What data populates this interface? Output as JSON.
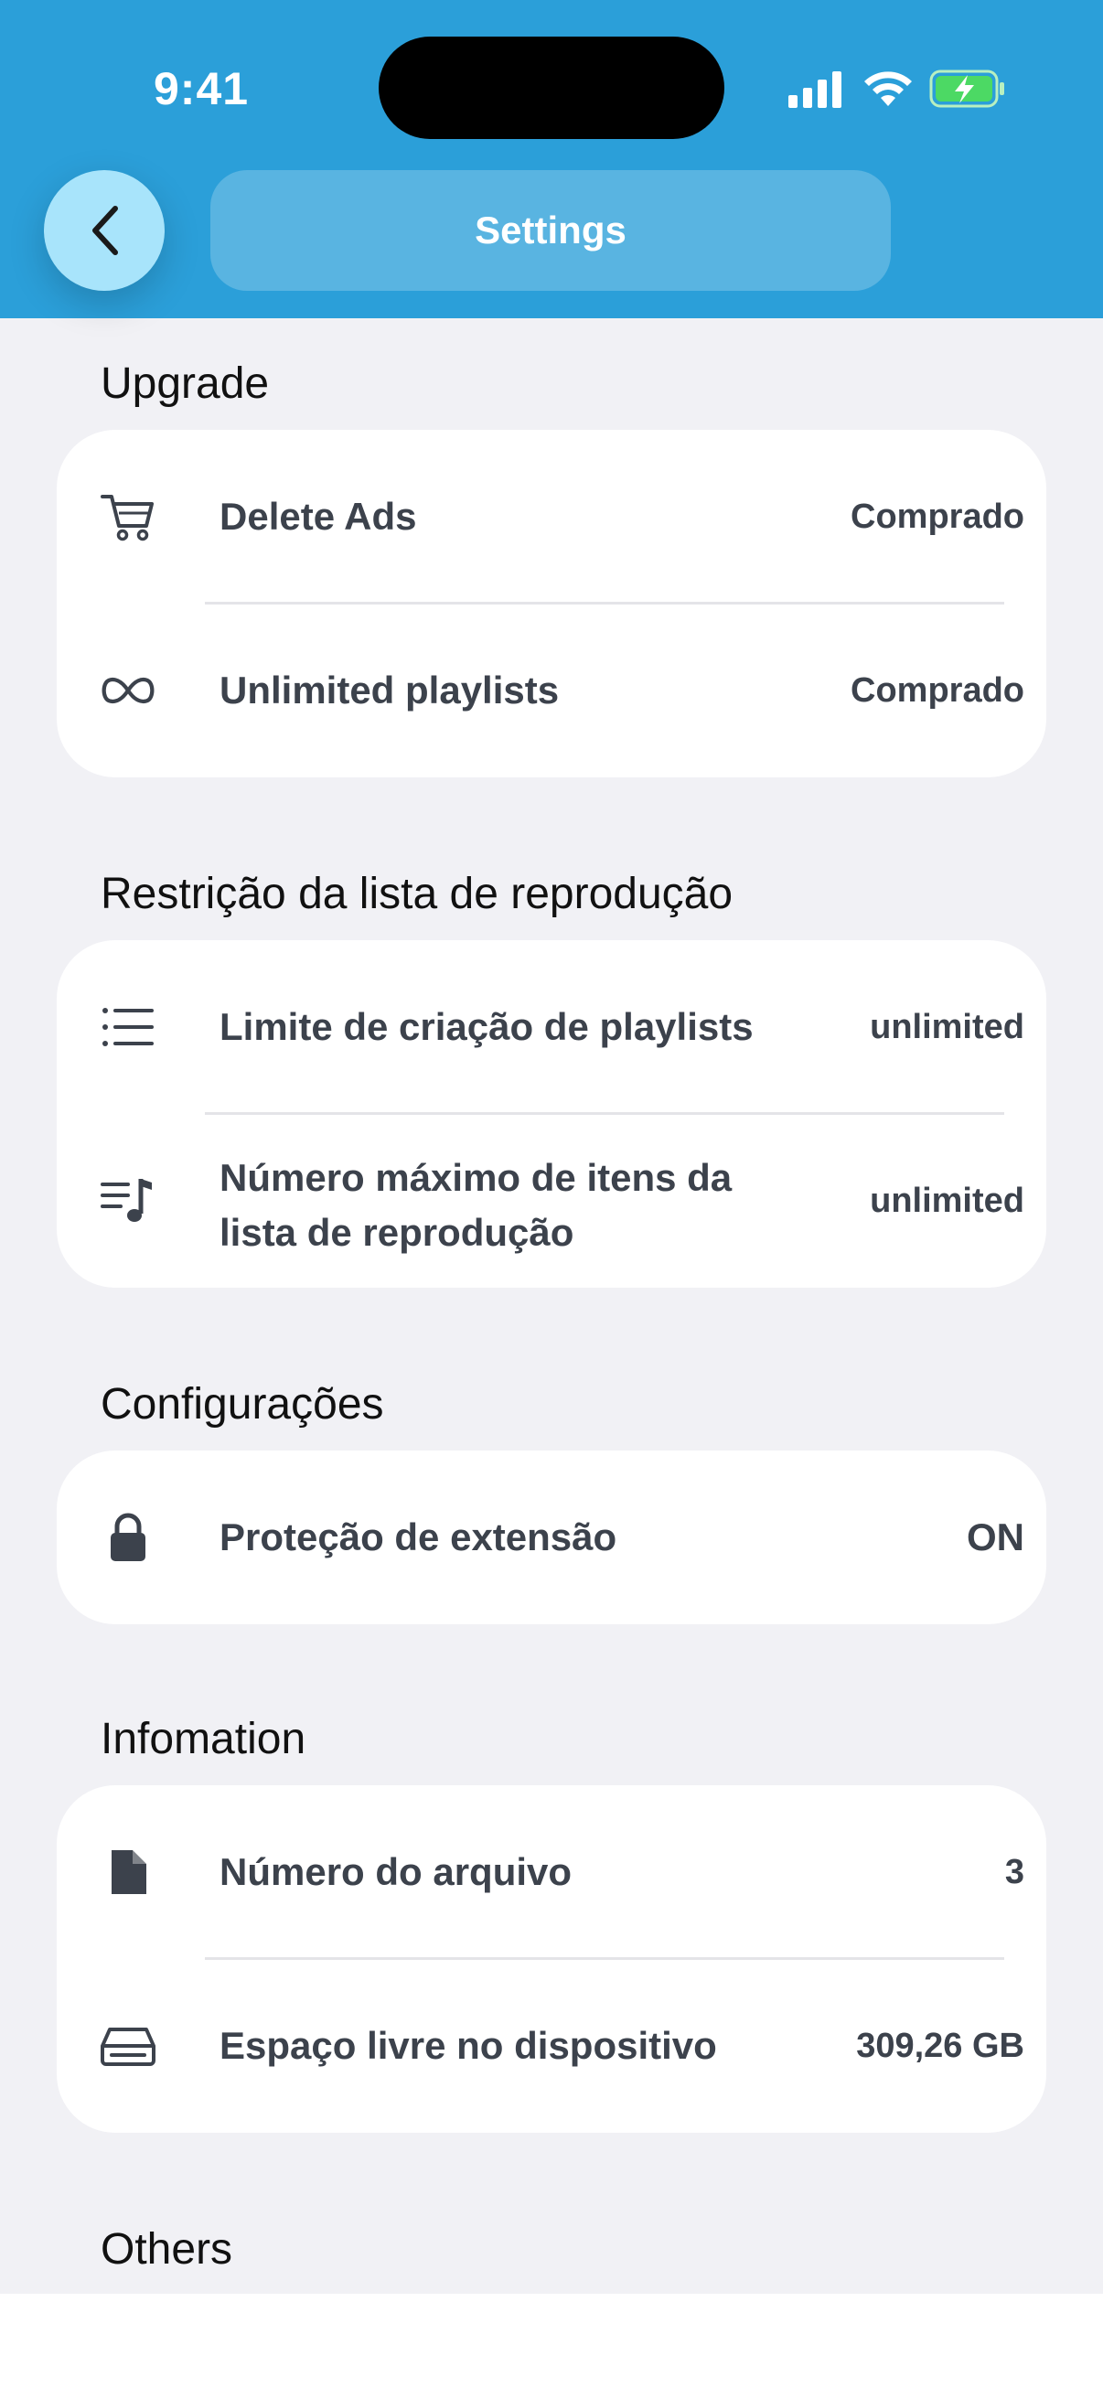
{
  "status_bar": {
    "time": "9:41"
  },
  "header": {
    "title": "Settings"
  },
  "sections": {
    "upgrade": {
      "title": "Upgrade",
      "rows": [
        {
          "label": "Delete Ads",
          "value": "Comprado",
          "icon": "cart-icon"
        },
        {
          "label": "Unlimited playlists",
          "value": "Comprado",
          "icon": "infinity-icon"
        }
      ]
    },
    "restriction": {
      "title": "Restrição da lista de reprodução",
      "rows": [
        {
          "label": "Limite de criação de playlists",
          "value": "unlimited",
          "icon": "list-icon"
        },
        {
          "label_line1": "Número máximo de itens da",
          "label_line2": "lista de reprodução",
          "value": "unlimited",
          "icon": "music-list-icon"
        }
      ]
    },
    "config": {
      "title": "Configurações",
      "rows": [
        {
          "label": "Proteção de extensão",
          "value": "ON",
          "icon": "lock-icon"
        }
      ]
    },
    "info": {
      "title": "Infomation",
      "rows": [
        {
          "label": "Número do arquivo",
          "value": "3",
          "icon": "file-icon"
        },
        {
          "label": "Espaço livre no dispositivo",
          "value": "309,26 GB",
          "icon": "storage-icon"
        }
      ]
    },
    "others": {
      "title": "Others"
    }
  },
  "colors": {
    "header": "#2b9fd9",
    "back_button": "#a8e4fb",
    "background": "#f1f1f5"
  }
}
